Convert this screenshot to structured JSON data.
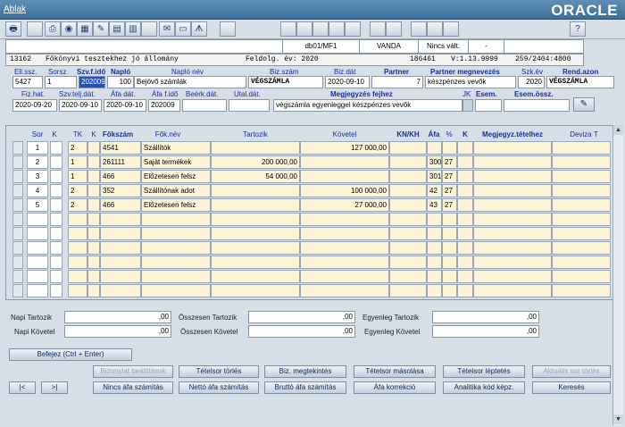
{
  "window": {
    "menu": "Ablak",
    "logo": "ORACLE"
  },
  "toolbar": {
    "icons": [
      "printer-icon",
      "print-icon",
      "globe-icon",
      "calc-icon",
      "edit-icon",
      "doc-icon",
      "table-icon",
      "mail-icon",
      "sheet-icon",
      "tool-icon",
      "help-icon"
    ]
  },
  "statusbar": {
    "db": "db01/MF1",
    "user": "VANDA",
    "change": "Nincs vált.",
    "dash": "-"
  },
  "context": {
    "code": "13162",
    "title": "Főkönyvi tesztekhez jó állomány",
    "year": "Feldolg. év: 2020",
    "num": "186461",
    "version": "V:1.13.9999",
    "ratio": "259/2404:4800"
  },
  "header": {
    "labels": {
      "ell_ssz": "Ell.ssz.",
      "sorsz": "Sorsz",
      "szv_fido": "Szv.f.idő",
      "naplo": "Napló",
      "naplo_nev": "Napló név",
      "biz_szam": "Biz.szám",
      "biz_dat": "Biz.dát",
      "partner": "Partner",
      "partner_megn": "Partner megnevezés",
      "szk_ev": "Szk.év",
      "rend_azon": "Rend.azon",
      "fiz_hat": "Fiz.hat.",
      "szv_telj": "Szv.telj.dát.",
      "afa_dat": "Áfa dát.",
      "afa_fido": "Áfa f.idő",
      "beerk_dat": "Beérk.dát.",
      "utal_dat": "Utal.dát.",
      "megj_fejhez": "Megjegyzés fejhez",
      "jk": "JK",
      "esem": "Esem.",
      "esem_ossz": "Esem.össz."
    },
    "values": {
      "ell_ssz": "5427",
      "sorsz": "1",
      "szv_fido": "202009",
      "naplo": "100",
      "naplo_nev": "Bejövő számlák",
      "biz_szam": "VÉGSZÁMLA",
      "biz_dat": "2020-09-10",
      "partner": "7",
      "partner_megn": "készpénzes vevők",
      "szk_ev": "2020",
      "rend_azon": "VÉGSZÁMLA",
      "fiz_hat": "2020-09-20",
      "szv_telj": "2020-09-10",
      "afa_dat": "2020-09-10",
      "afa_fido": "202009",
      "megj_fejhez": "végszámla egyenleggel    készpénzes vevők"
    }
  },
  "grid": {
    "headers": {
      "sor": "Sor",
      "k": "K",
      "tk": "TK",
      "k2": "K",
      "fokszam": "Főkszám",
      "foknev": "Fők.név",
      "tartozik": "Tartozik",
      "kovetel": "Követel",
      "knkh": "KN/KH",
      "afa": "Áfa",
      "pct": "%",
      "k3": "K",
      "megjegyz": "Megjegyz.tételhez",
      "deviza": "Deviza T"
    },
    "rows": [
      {
        "sor": "1",
        "tk": "2",
        "fokszam": "4541",
        "foknev": "Szállítók",
        "tartozik": "",
        "kovetel": "127 000,00",
        "afa": "",
        "pct": ""
      },
      {
        "sor": "2",
        "tk": "1",
        "fokszam": "261111",
        "foknev": "Saját termékek",
        "tartozik": "200 000,00",
        "kovetel": "",
        "afa": "300",
        "pct": "27"
      },
      {
        "sor": "3",
        "tk": "1",
        "fokszam": "466",
        "foknev": "Előzetesen felsz",
        "tartozik": "54 000,00",
        "kovetel": "",
        "afa": "301",
        "pct": "27"
      },
      {
        "sor": "4",
        "tk": "2",
        "fokszam": "352",
        "foknev": "Szállítónak adot",
        "tartozik": "",
        "kovetel": "100 000,00",
        "afa": "42",
        "pct": "27"
      },
      {
        "sor": "5",
        "tk": "2",
        "fokszam": "466",
        "foknev": "Előzetesen felsz",
        "tartozik": "",
        "kovetel": "27 000,00",
        "afa": "43",
        "pct": "27"
      }
    ]
  },
  "totals": {
    "napi_tartozik": "Napi Tartozik",
    "napi_kovetel": "Napi Követel",
    "ossz_tartozik": "Összesen Tartozik",
    "ossz_kovetel": "Összesen Követel",
    "egy_tartozik": "Egyenleg Tartozik",
    "egy_kovetel": "Egyenleg Követel",
    "v_napi_t": ",00",
    "v_napi_k": ",00",
    "v_ossz_t": ",00",
    "v_ossz_k": ",00",
    "v_egy_t": ",00",
    "v_egy_k": ",00"
  },
  "buttons": {
    "befejez": "Befejez (Ctrl + Enter)",
    "bizonylat_beallitasok": "Bizonylat beállítások",
    "tetelsor_torles": "Tételsor törlés",
    "biz_megtekintes": "Biz. megtekintés",
    "tetelsor_masolasa": "Tételsor másolása",
    "tetelsor_leptetes": "Tételsor léptetés",
    "aktualis_sor_torles": "Aktuális sor törlés",
    "first": "|<",
    "last": ">|",
    "nincs_afa": "Nincs áfa számítás",
    "netto_afa": "Nettó áfa számítás",
    "brutto_afa": "Bruttó áfa számítás",
    "afa_korrekcio": "Áfa korrekció",
    "analitika": "Analitika kód képz.",
    "kereses": "Keresés"
  }
}
